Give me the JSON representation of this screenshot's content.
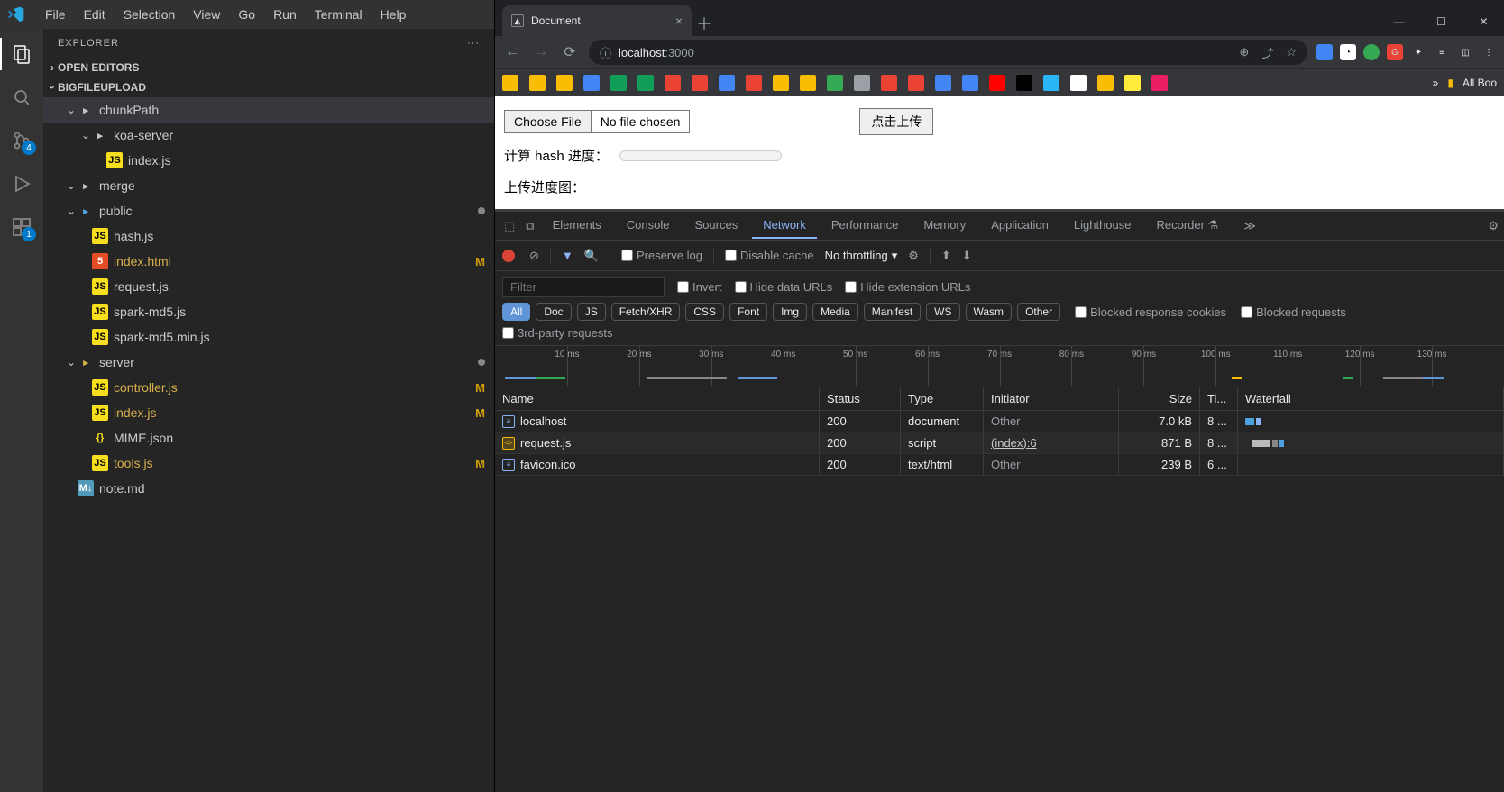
{
  "vscode": {
    "menu": [
      "File",
      "Edit",
      "Selection",
      "View",
      "Go",
      "Run",
      "Terminal",
      "Help"
    ],
    "explorer_title": "EXPLORER",
    "open_editors": "OPEN EDITORS",
    "project": "BIGFILEUPLOAD",
    "scm_badge": "4",
    "ext_badge": "1",
    "tree": [
      {
        "depth": 1,
        "type": "folder",
        "open": true,
        "label": "chunkPath",
        "selected": true
      },
      {
        "depth": 2,
        "type": "folder",
        "open": true,
        "label": "koa-server"
      },
      {
        "depth": 3,
        "type": "js",
        "label": "index.js"
      },
      {
        "depth": 1,
        "type": "folder",
        "open": true,
        "label": "merge"
      },
      {
        "depth": 1,
        "type": "folder-blue",
        "open": true,
        "label": "public",
        "git": "dot"
      },
      {
        "depth": 2,
        "type": "js",
        "label": "hash.js"
      },
      {
        "depth": 2,
        "type": "html",
        "label": "index.html",
        "git": "M"
      },
      {
        "depth": 2,
        "type": "js",
        "label": "request.js"
      },
      {
        "depth": 2,
        "type": "js",
        "label": "spark-md5.js"
      },
      {
        "depth": 2,
        "type": "js",
        "label": "spark-md5.min.js"
      },
      {
        "depth": 1,
        "type": "folder-srv",
        "open": true,
        "label": "server",
        "git": "dot"
      },
      {
        "depth": 2,
        "type": "js",
        "label": "controller.js",
        "git": "M"
      },
      {
        "depth": 2,
        "type": "js",
        "label": "index.js",
        "git": "M"
      },
      {
        "depth": 2,
        "type": "json",
        "label": "MIME.json"
      },
      {
        "depth": 2,
        "type": "js",
        "label": "tools.js",
        "git": "M"
      },
      {
        "depth": 1,
        "type": "md",
        "label": "note.md"
      }
    ]
  },
  "browser": {
    "tab_title": "Document",
    "url_info_label": "ⓘ",
    "url_host": "localhost",
    "url_port": ":3000",
    "bookmarks_more": "All Boo",
    "page": {
      "choose_file": "Choose File",
      "no_file": "No file chosen",
      "upload_btn": "点击上传",
      "hash_label": "计算 hash 进度：",
      "progress_label": "上传进度图："
    }
  },
  "devtools": {
    "tabs": [
      "Elements",
      "Console",
      "Sources",
      "Network",
      "Performance",
      "Memory",
      "Application",
      "Lighthouse",
      "Recorder"
    ],
    "active_tab": "Network",
    "recorder_flask": "⚗",
    "more": "≫",
    "preserve_log": "Preserve log",
    "disable_cache": "Disable cache",
    "throttling": "No throttling",
    "filter_placeholder": "Filter",
    "invert": "Invert",
    "hide_data_urls": "Hide data URLs",
    "hide_ext_urls": "Hide extension URLs",
    "chips": [
      "All",
      "Doc",
      "JS",
      "Fetch/XHR",
      "CSS",
      "Font",
      "Img",
      "Media",
      "Manifest",
      "WS",
      "Wasm",
      "Other"
    ],
    "blocked_cookies": "Blocked response cookies",
    "blocked_requests": "Blocked requests",
    "third_party": "3rd-party requests",
    "timeline_ticks": [
      "10 ms",
      "20 ms",
      "30 ms",
      "40 ms",
      "50 ms",
      "60 ms",
      "70 ms",
      "80 ms",
      "90 ms",
      "100 ms",
      "110 ms",
      "120 ms",
      "130 ms"
    ],
    "columns": [
      "Name",
      "Status",
      "Type",
      "Initiator",
      "Size",
      "Ti...",
      "Waterfall"
    ],
    "rows": [
      {
        "icon": "doc",
        "name": "localhost",
        "status": "200",
        "type": "document",
        "initiator": "Other",
        "initiator_gray": true,
        "size": "7.0 kB",
        "time": "8 ...",
        "wf": [
          {
            "w": 10,
            "c": "#4ea1df",
            "l": 0
          },
          {
            "w": 6,
            "c": "#8ab4f8",
            "l": 12
          }
        ]
      },
      {
        "icon": "js",
        "name": "request.js",
        "status": "200",
        "type": "script",
        "initiator": "(index):6",
        "initiator_gray": false,
        "size": "871 B",
        "time": "8 ...",
        "wf": [
          {
            "w": 20,
            "c": "#bbb",
            "l": 8
          },
          {
            "w": 6,
            "c": "#888",
            "l": 30
          },
          {
            "w": 5,
            "c": "#4ea1df",
            "l": 38
          }
        ]
      },
      {
        "icon": "doc",
        "name": "favicon.ico",
        "status": "200",
        "type": "text/html",
        "initiator": "Other",
        "initiator_gray": true,
        "size": "239 B",
        "time": "6 ..."
      }
    ]
  }
}
